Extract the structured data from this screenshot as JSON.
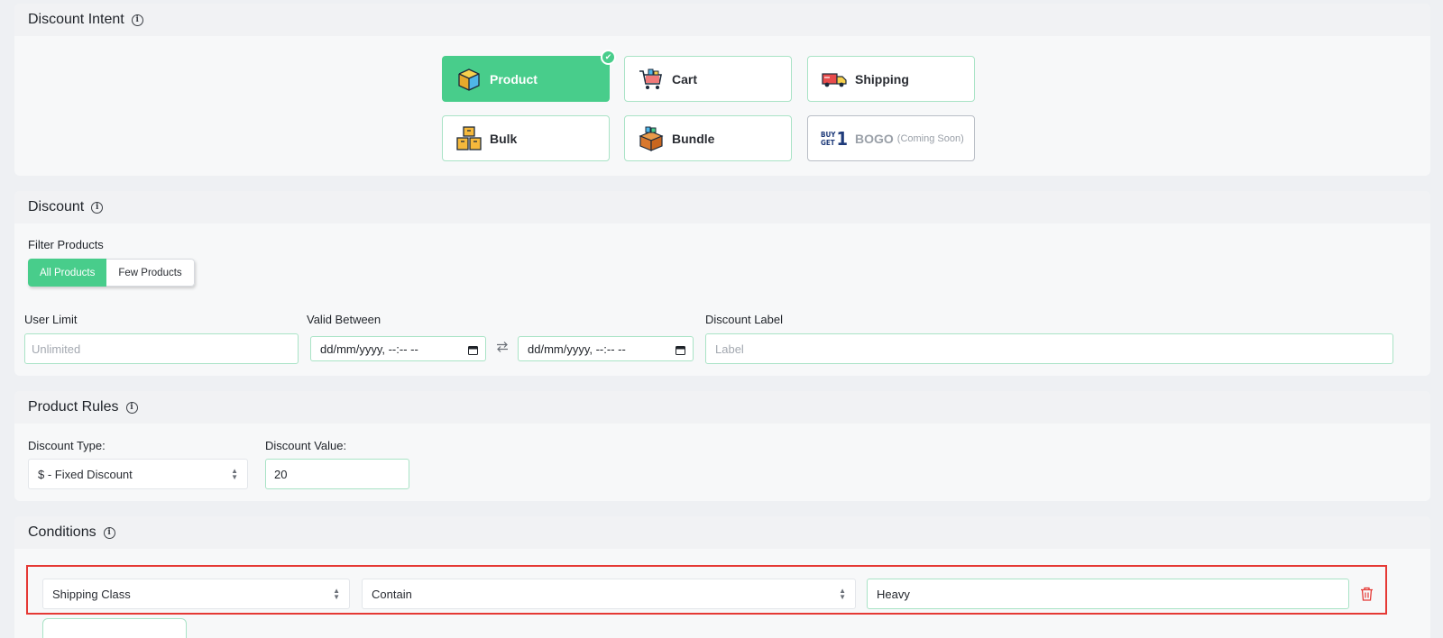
{
  "intent": {
    "title": "Discount Intent",
    "tiles": [
      {
        "label": "Product",
        "icon": "product-box-icon",
        "selected": true
      },
      {
        "label": "Cart",
        "icon": "cart-icon"
      },
      {
        "label": "Shipping",
        "icon": "shipping-truck-icon"
      },
      {
        "label": "Bulk",
        "icon": "bulk-boxes-icon"
      },
      {
        "label": "Bundle",
        "icon": "bundle-box-icon"
      },
      {
        "label": "BOGO",
        "note": "(Coming Soon)",
        "icon": "buy-get-1-icon",
        "disabled": true
      }
    ],
    "bogo_icon_text": {
      "line1": "BUY",
      "line2": "GET",
      "num": "1"
    }
  },
  "discount": {
    "title": "Discount",
    "filter_label": "Filter Products",
    "filter_options": [
      "All Products",
      "Few Products"
    ],
    "filter_selected": "All Products",
    "user_limit_label": "User Limit",
    "user_limit_placeholder": "Unlimited",
    "valid_between_label": "Valid Between",
    "date_from": "dd/mm/yyyy, --:-- --",
    "date_to": "dd/mm/yyyy, --:-- --",
    "label_label": "Discount Label",
    "label_placeholder": "Label"
  },
  "product_rules": {
    "title": "Product Rules",
    "type_label": "Discount Type:",
    "type_value": "$ - Fixed Discount",
    "value_label": "Discount Value:",
    "value": "20"
  },
  "conditions": {
    "title": "Conditions",
    "rule": {
      "field": "Shipping Class",
      "operator": "Contain",
      "value": "Heavy"
    }
  },
  "colors": {
    "accent": "#48cd8b",
    "highlight": "#e53935",
    "delete": "#e53935"
  }
}
